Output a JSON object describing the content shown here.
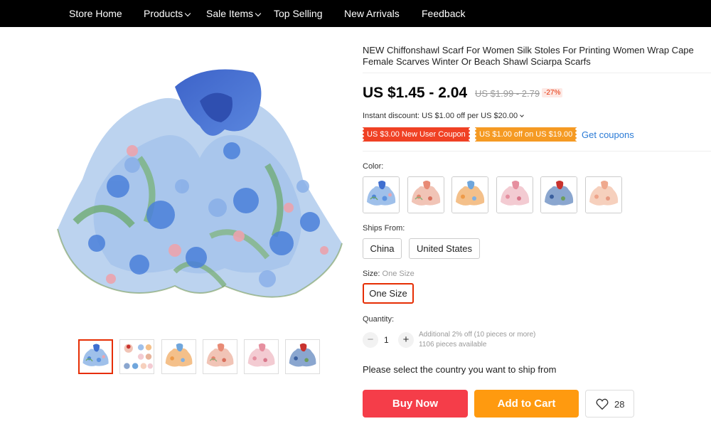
{
  "nav": {
    "store_home": "Store Home",
    "products": "Products",
    "sale_items": "Sale Items",
    "top_selling": "Top Selling",
    "new_arrivals": "New Arrivals",
    "feedback": "Feedback"
  },
  "product": {
    "title": "NEW Chiffonshawl Scarf For Women Silk Stoles For Printing Women Wrap Cape Female Scarves Winter Or Beach Shawl Sciarpa Scarfs",
    "price": "US $1.45 - 2.04",
    "original_price": "US $1.99 - 2.79",
    "discount": "-27%",
    "instant_discount": "Instant discount: US $1.00 off per US $20.00"
  },
  "coupons": {
    "new_user": "US $3.00 New User Coupon",
    "off": "US $1.00 off on US $19.00",
    "get_coupons": "Get coupons"
  },
  "color": {
    "label": "Color:",
    "swatches": [
      "blue",
      "coral",
      "orange",
      "pink",
      "navy",
      "peach"
    ]
  },
  "ships_from": {
    "label": "Ships From:",
    "options": [
      "China",
      "United States"
    ]
  },
  "size": {
    "label": "Size:",
    "selected_value": "One Size",
    "options": [
      "One Size"
    ]
  },
  "quantity": {
    "label": "Quantity:",
    "value": "1",
    "minus": "−",
    "plus": "+",
    "additional_off": "Additional 2% off (10 pieces or more)",
    "available": "1106 pieces available"
  },
  "ship_message": "Please select the country you want to ship from",
  "actions": {
    "buy_now": "Buy Now",
    "add_to_cart": "Add to Cart",
    "wishlist_count": "28"
  },
  "colors": {
    "nav_bg": "#000000",
    "accent_red": "#e62e04",
    "buy_now": "#f53d49",
    "add_to_cart": "#ff9a0f",
    "link_blue": "#2b7bd6"
  },
  "icons": {
    "nav_dropdown": "chevron-down-icon",
    "wishlist": "heart-icon"
  }
}
